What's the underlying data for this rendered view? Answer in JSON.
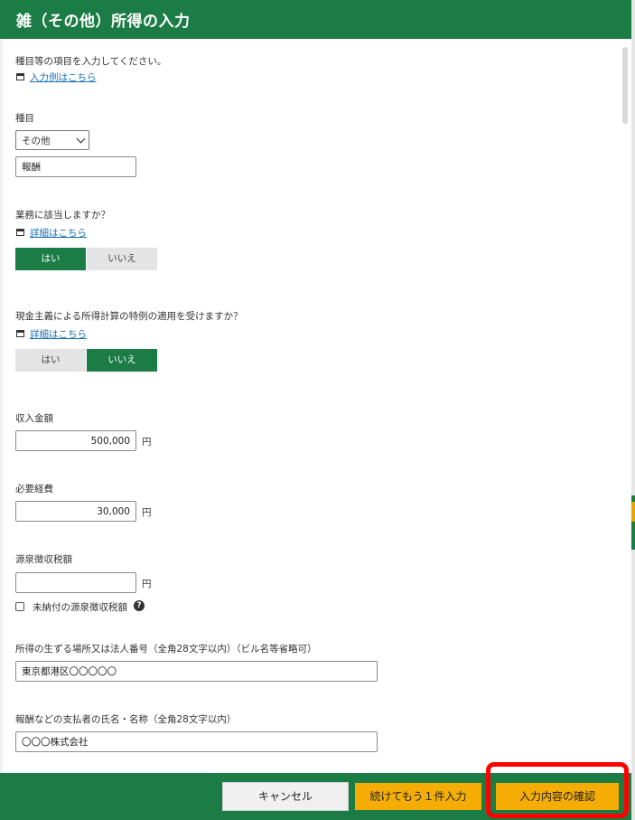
{
  "header": {
    "title": "雑（その他）所得の入力"
  },
  "intro": {
    "text": "種目等の項目を入力してください。",
    "example_link": "入力例はこちら"
  },
  "category": {
    "label": "種目",
    "selected": "その他",
    "detail_value": "報酬"
  },
  "business": {
    "question": "業務に該当しますか？",
    "detail_link": "詳細はこちら",
    "options": [
      "はい",
      "いいえ"
    ],
    "selected": "はい"
  },
  "cash_basis": {
    "question": "現金主義による所得計算の特例の適用を受けますか？",
    "detail_link": "詳細はこちら",
    "options": [
      "はい",
      "いいえ"
    ],
    "selected": "いいえ"
  },
  "income": {
    "label": "収入金額",
    "value": "500,000",
    "unit": "円"
  },
  "expenses": {
    "label": "必要経費",
    "value": "30,000",
    "unit": "円"
  },
  "withholding": {
    "label": "源泉徴収税額",
    "value": "",
    "unit": "円",
    "unpaid_checkbox_label": "未納付の源泉徴収税額",
    "unpaid_checked": false,
    "help_symbol": "?"
  },
  "location": {
    "label": "所得の生ずる場所又は法人番号（全角28文字以内）（ビル名等省略可）",
    "value": "東京都港区〇〇〇〇〇"
  },
  "payer": {
    "label": "報酬などの支払者の氏名・名称（全角28文字以内）",
    "value": "〇〇〇株式会社"
  },
  "footer": {
    "cancel_label": "キャンセル",
    "continue_label": "続けてもう１件入力",
    "confirm_label": "入力内容の確認"
  },
  "colors": {
    "brand_green": "#1b7c45",
    "button_yellow": "#f5ad06",
    "highlight_red": "#ff0000",
    "link_blue": "#1a6fb5"
  }
}
